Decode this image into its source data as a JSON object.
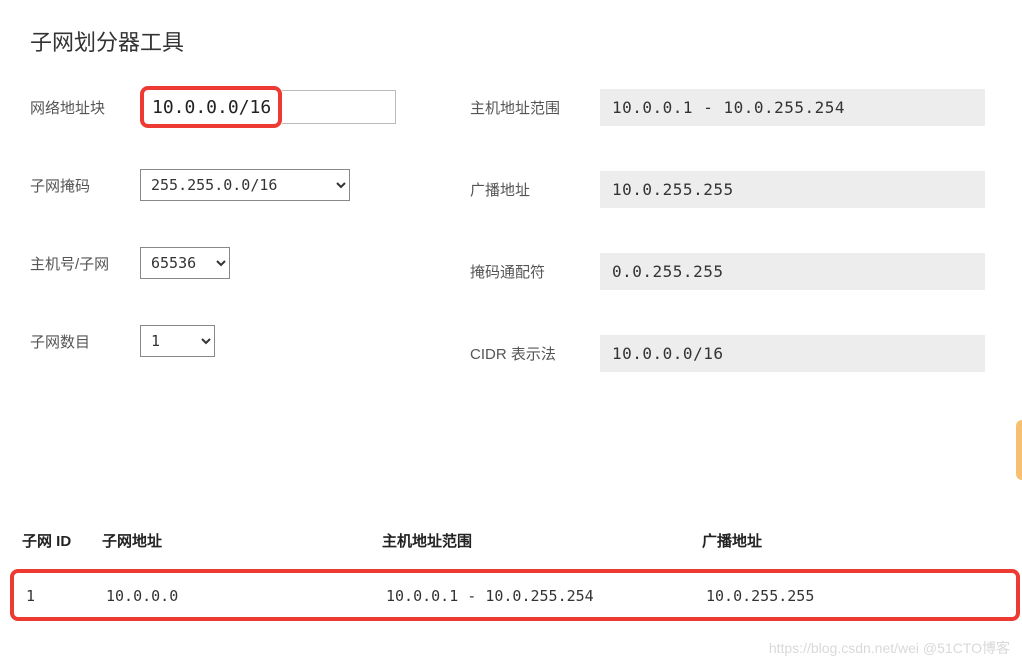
{
  "title": "子网划分器工具",
  "left": {
    "network_block_label": "网络地址块",
    "network_block_value": "10.0.0.0/16",
    "subnet_mask_label": "子网掩码",
    "subnet_mask_value": "255.255.0.0/16",
    "hosts_per_subnet_label": "主机号/子网",
    "hosts_per_subnet_value": "65536",
    "subnet_count_label": "子网数目",
    "subnet_count_value": "1"
  },
  "right": {
    "host_range_label": "主机地址范围",
    "host_range_value": "10.0.0.1  -  10.0.255.254",
    "broadcast_label": "广播地址",
    "broadcast_value": "10.0.255.255",
    "wildcard_label": "掩码通配符",
    "wildcard_value": "0.0.255.255",
    "cidr_label": "CIDR 表示法",
    "cidr_value": "10.0.0.0/16"
  },
  "table": {
    "headers": {
      "id": "子网 ID",
      "addr": "子网地址",
      "range": "主机地址范围",
      "bcast": "广播地址"
    },
    "row": {
      "id": "1",
      "addr": "10.0.0.0",
      "range": "10.0.0.1 - 10.0.255.254",
      "bcast": "10.0.255.255"
    }
  },
  "watermark": "https://blog.csdn.net/wei   @51CTO博客"
}
